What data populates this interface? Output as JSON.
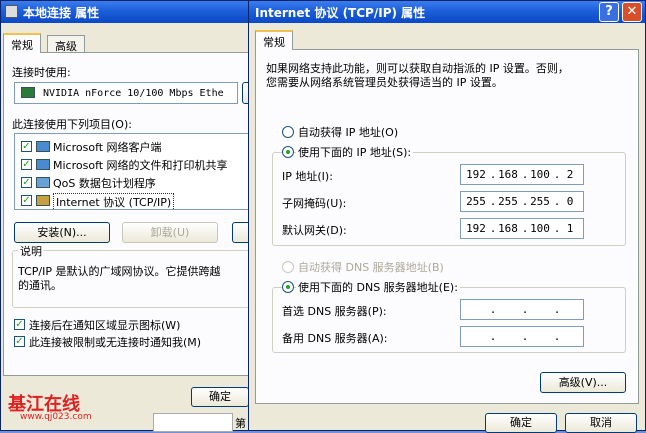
{
  "left_window": {
    "title": "本地连接 属性",
    "tabs": [
      "常规",
      "高级"
    ],
    "connect_using_label": "连接时使用:",
    "adapter_name": "NVIDIA nForce 10/100 Mbps Ethe",
    "components_label": "此连接使用下列项目(O):",
    "components": [
      {
        "label": "Microsoft 网络客户端",
        "checked": true
      },
      {
        "label": "Microsoft 网络的文件和打印机共享",
        "checked": true
      },
      {
        "label": "QoS 数据包计划程序",
        "checked": true
      },
      {
        "label": "Internet 协议 (TCP/IP)",
        "checked": true
      }
    ],
    "install_button": "安装(N)...",
    "uninstall_button": "卸载(U)",
    "description_group": "说明",
    "description_text_1": "TCP/IP 是默认的广域网协议。它提供跨越",
    "description_text_2": "的通讯。",
    "show_icon_label": "连接后在通知区域显示图标(W)",
    "notify_label": "此连接被限制或无连接时通知我(M)",
    "ok_button": "确定",
    "behind_text": "第"
  },
  "right_window": {
    "title": "Internet 协议 (TCP/IP) 属性",
    "help_button": "?",
    "close_button": "✕",
    "tab": "常规",
    "intro_line_1": "如果网络支持此功能，则可以获取自动指派的 IP 设置。否则，",
    "intro_line_2": "您需要从网络系统管理员处获得适当的 IP 设置。",
    "auto_ip_label": "自动获得 IP 地址(O)",
    "manual_ip_label": "使用下面的 IP 地址(S):",
    "ip_address_label": "IP 地址(I):",
    "ip_address": [
      "192",
      "168",
      "100",
      "2"
    ],
    "subnet_label": "子网掩码(U):",
    "subnet": [
      "255",
      "255",
      "255",
      "0"
    ],
    "gateway_label": "默认网关(D):",
    "gateway": [
      "192",
      "168",
      "100",
      "1"
    ],
    "auto_dns_label": "自动获得 DNS 服务器地址(B)",
    "manual_dns_label": "使用下面的 DNS 服务器地址(E):",
    "preferred_dns_label": "首选 DNS 服务器(P):",
    "alternate_dns_label": "备用 DNS 服务器(A):",
    "advanced_button": "高级(V)...",
    "ok_button": "确定",
    "cancel_button": "取消"
  },
  "watermark": {
    "text": "基江在线",
    "url": "www.qj023.com"
  }
}
